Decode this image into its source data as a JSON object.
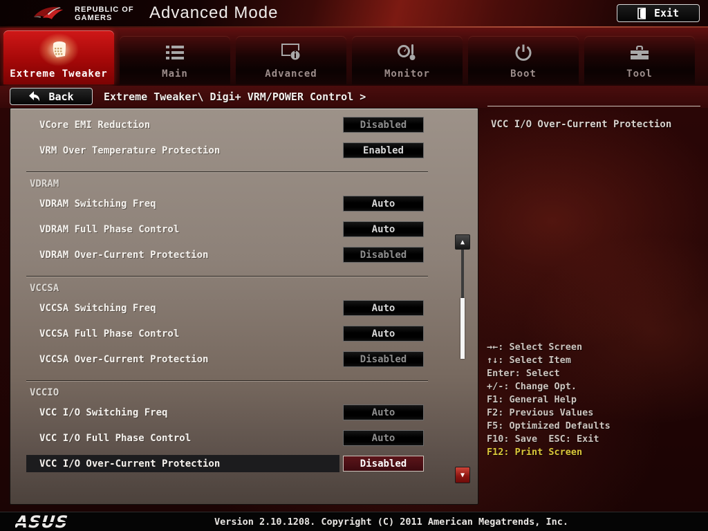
{
  "header": {
    "brand_top": "REPUBLIC OF",
    "brand_bottom": "GAMERS",
    "title": "Advanced Mode",
    "exit_label": "Exit"
  },
  "tabs": [
    {
      "label": "Extreme Tweaker",
      "icon": "extreme-tweaker-icon",
      "active": true
    },
    {
      "label": "Main",
      "icon": "list-icon",
      "active": false
    },
    {
      "label": "Advanced",
      "icon": "screen-info-icon",
      "active": false
    },
    {
      "label": "Monitor",
      "icon": "gauge-thermometer-icon",
      "active": false
    },
    {
      "label": "Boot",
      "icon": "power-icon",
      "active": false
    },
    {
      "label": "Tool",
      "icon": "toolbox-icon",
      "active": false
    }
  ],
  "breadcrumb": {
    "back_label": "Back",
    "path": "Extreme Tweaker\\ Digi+ VRM/POWER Control >"
  },
  "settings": {
    "groups": [
      {
        "header": null,
        "items": [
          {
            "label": "VCore EMI Reduction",
            "value": "Disabled",
            "dim": true,
            "selected": false
          },
          {
            "label": "VRM Over Temperature Protection",
            "value": "Enabled",
            "dim": false,
            "selected": false
          }
        ]
      },
      {
        "header": "VDRAM",
        "items": [
          {
            "label": "VDRAM Switching Freq",
            "value": "Auto",
            "dim": false,
            "selected": false
          },
          {
            "label": "VDRAM Full Phase Control",
            "value": "Auto",
            "dim": false,
            "selected": false
          },
          {
            "label": "VDRAM Over-Current Protection",
            "value": "Disabled",
            "dim": true,
            "selected": false
          }
        ]
      },
      {
        "header": "VCCSA",
        "items": [
          {
            "label": "VCCSA Switching Freq",
            "value": "Auto",
            "dim": false,
            "selected": false
          },
          {
            "label": "VCCSA Full Phase Control",
            "value": "Auto",
            "dim": false,
            "selected": false
          },
          {
            "label": "VCCSA Over-Current Protection",
            "value": "Disabled",
            "dim": true,
            "selected": false
          }
        ]
      },
      {
        "header": "VCCIO",
        "items": [
          {
            "label": "VCC I/O Switching Freq",
            "value": "Auto",
            "dim": true,
            "selected": false
          },
          {
            "label": "VCC I/O Full Phase Control",
            "value": "Auto",
            "dim": true,
            "selected": false
          },
          {
            "label": "VCC I/O Over-Current Protection",
            "value": "Disabled",
            "dim": false,
            "selected": true
          }
        ]
      }
    ]
  },
  "scrollbar": {
    "up_glyph": "▲",
    "down_glyph": "▼"
  },
  "help_panel": {
    "title": "VCC I/O Over-Current Protection",
    "shortcuts": [
      {
        "text": "→←: Select Screen",
        "highlight": false
      },
      {
        "text": "↑↓: Select Item",
        "highlight": false
      },
      {
        "text": "Enter: Select",
        "highlight": false
      },
      {
        "text": "+/-: Change Opt.",
        "highlight": false
      },
      {
        "text": "F1: General Help",
        "highlight": false
      },
      {
        "text": "F2: Previous Values",
        "highlight": false
      },
      {
        "text": "F5: Optimized Defaults",
        "highlight": false
      },
      {
        "text": "F10: Save  ESC: Exit",
        "highlight": false
      },
      {
        "text": "F12: Print Screen",
        "highlight": true
      }
    ]
  },
  "footer": {
    "brand": "ASUS",
    "version_text": "Version 2.10.1208. Copyright (C) 2011 American Megatrends, Inc."
  },
  "colors": {
    "rog_red": "#b01212",
    "active_tab_red": "#c01414",
    "selected_value_bg": "#4a0f14",
    "legend_highlight": "#dcc83a"
  }
}
